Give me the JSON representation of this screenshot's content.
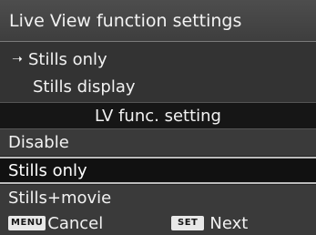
{
  "title": "Live View function settings",
  "current": {
    "line1": "Stills only",
    "line2": "Stills display",
    "arrow_icon": "arrow-right-icon"
  },
  "section_header": "LV func. setting",
  "options": [
    {
      "label": "Disable",
      "selected": false
    },
    {
      "label": "Stills only",
      "selected": true
    },
    {
      "label": "Stills+movie",
      "selected": false
    }
  ],
  "footer": {
    "menu_key": "MENU",
    "cancel_label": "Cancel",
    "set_key": "SET",
    "next_label": "Next"
  },
  "colors": {
    "title_bg": "#444444",
    "selected_bg": "#111111",
    "selected_border": "#bbbbbb",
    "option_bg": "#3a3a3a"
  }
}
